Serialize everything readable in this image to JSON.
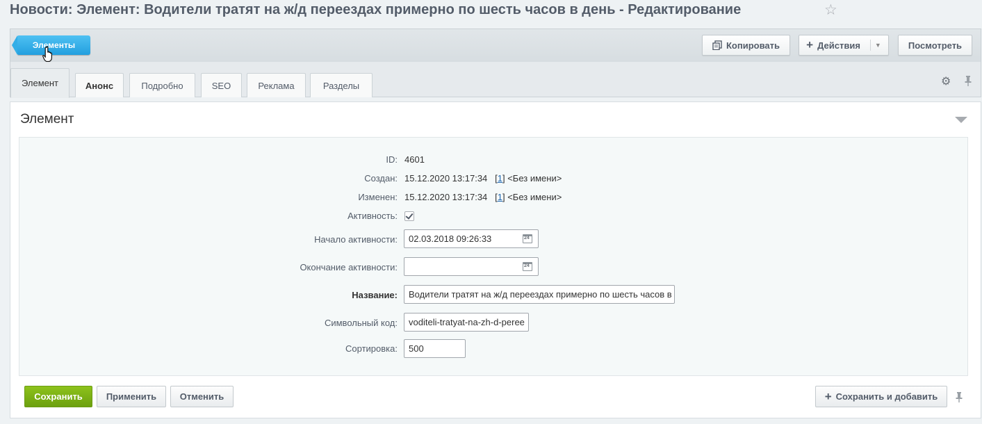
{
  "header": {
    "title": "Новости: Элемент: Водители тратят на ж/д переездах примерно по шесть часов в день - Редактирование",
    "favorite_icon": "star-icon"
  },
  "toolbar": {
    "back_label": "Элементы",
    "copy_label": "Копировать",
    "actions_label": "Действия",
    "view_label": "Посмотреть",
    "accent_color": "#229fdf"
  },
  "tabs": [
    {
      "label": "Элемент",
      "active": true
    },
    {
      "label": "Анонс"
    },
    {
      "label": "Подробно"
    },
    {
      "label": "SEO"
    },
    {
      "label": "Реклама"
    },
    {
      "label": "Разделы"
    }
  ],
  "section": {
    "title": "Элемент"
  },
  "form": {
    "id_label": "ID:",
    "id_value": "4601",
    "created_label": "Создан:",
    "created_value": "15.12.2020 13:17:34",
    "created_user_id": "1",
    "created_user_name": "<Без имени>",
    "modified_label": "Изменен:",
    "modified_value": "15.12.2020 13:17:34",
    "modified_user_id": "1",
    "modified_user_name": "<Без имени>",
    "active_label": "Активность:",
    "active_checked": true,
    "active_from_label": "Начало активности:",
    "active_from_value": "02.03.2018 09:26:33",
    "active_to_label": "Окончание активности:",
    "active_to_value": "",
    "name_label": "Название:",
    "name_value": "Водители тратят на ж/д переездах примерно по шесть часов в",
    "code_label": "Символьный код:",
    "code_value": "voditeli-tratyat-na-zh-d-peree",
    "sort_label": "Сортировка:",
    "sort_value": "500"
  },
  "footer": {
    "save_label": "Сохранить",
    "apply_label": "Применить",
    "cancel_label": "Отменить",
    "save_add_label": "Сохранить и добавить",
    "save_color": "#7bb013"
  }
}
